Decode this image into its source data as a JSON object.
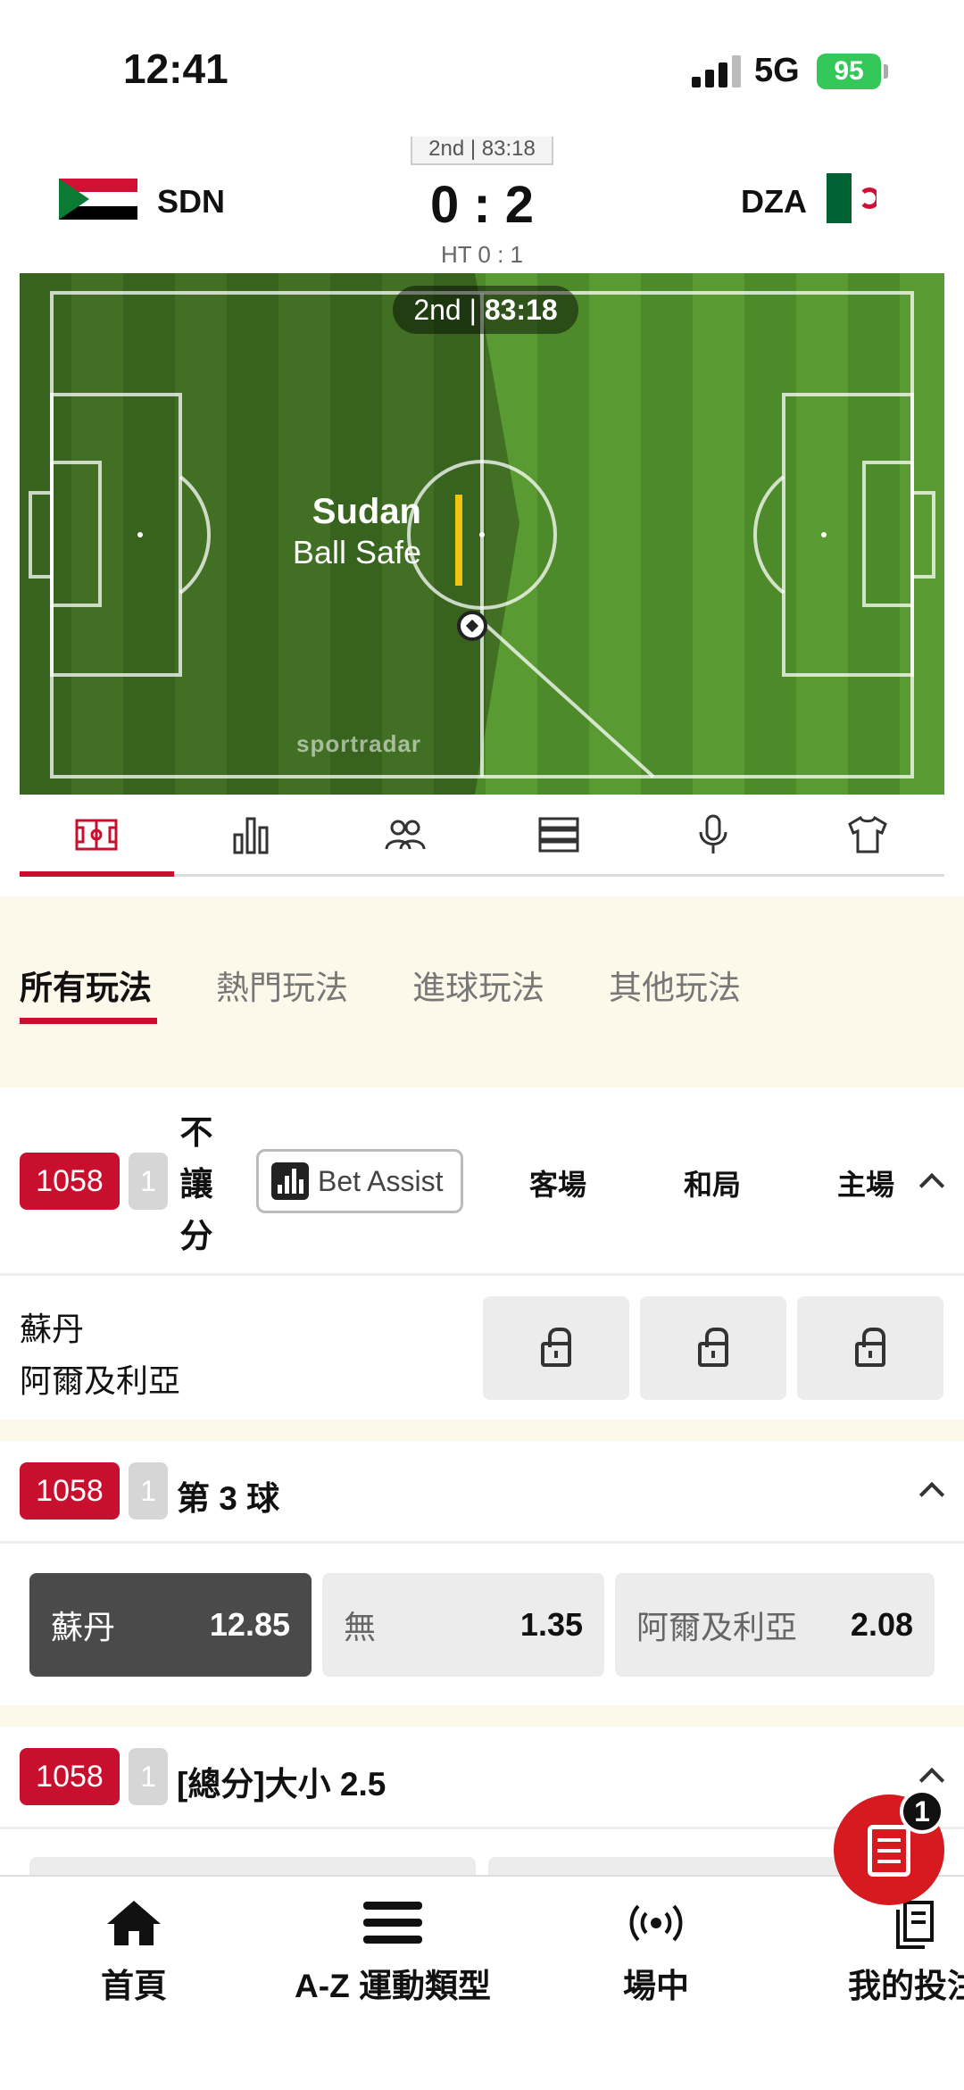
{
  "status_bar": {
    "time": "12:41",
    "network": "5G",
    "battery": "95"
  },
  "match": {
    "period_top": "2nd | 83:18",
    "home_code": "SDN",
    "away_code": "DZA",
    "score": "0 : 2",
    "halftime": "HT 0 : 1"
  },
  "tracker": {
    "period": "2nd",
    "clock": "83:18",
    "team": "Sudan",
    "state": "Ball Safe",
    "brand": "sportradar"
  },
  "icon_tabs": [
    {
      "icon": "pitch-icon",
      "active": true
    },
    {
      "icon": "bar-chart-icon"
    },
    {
      "icon": "players-icon"
    },
    {
      "icon": "list-icon"
    },
    {
      "icon": "microphone-icon"
    },
    {
      "icon": "jersey-icon"
    }
  ],
  "categories": [
    "所有玩法",
    "熱門玩法",
    "進球玩法",
    "其他玩法"
  ],
  "markets": [
    {
      "code": "1058",
      "num": "1",
      "title": "不讓分",
      "bet_assist": "Bet Assist",
      "columns": [
        "客場",
        "和局",
        "主場"
      ],
      "teams": [
        "蘇丹",
        "阿爾及利亞"
      ],
      "locked": true
    },
    {
      "code": "1058",
      "num": "1",
      "title": "第 3 球",
      "odds": [
        {
          "label": "蘇丹",
          "value": "12.85",
          "selected": true
        },
        {
          "label": "無",
          "value": "1.35"
        },
        {
          "label": "阿爾及利亞",
          "value": "2.08"
        }
      ]
    },
    {
      "code": "1058",
      "num": "1",
      "title": "[總分]大小 2.5"
    }
  ],
  "bet_slip": {
    "count": "1"
  },
  "bottom_nav": [
    {
      "label": "首頁",
      "icon": "home-icon"
    },
    {
      "label": "A-Z 運動類型",
      "icon": "menu-icon"
    },
    {
      "label": "場中",
      "icon": "live-icon"
    },
    {
      "label": "我的投注",
      "icon": "my-bets-icon"
    }
  ],
  "colors": {
    "brand_red": "#c8102e",
    "pitch_green": "#4d8a2a",
    "highlight_yellow": "#f1c40f"
  }
}
